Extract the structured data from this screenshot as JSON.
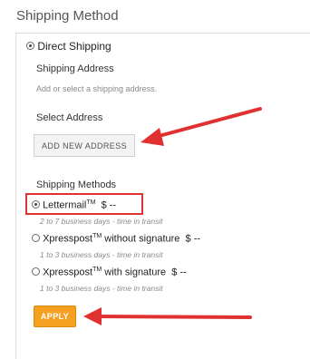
{
  "page": {
    "title": "Shipping Method"
  },
  "delivery": {
    "option_label": "Direct Shipping",
    "selected": true
  },
  "address": {
    "heading": "Shipping Address",
    "hint": "Add or select a shipping address.",
    "select_label": "Select Address",
    "add_button_label": "ADD NEW ADDRESS"
  },
  "methods": {
    "heading": "Shipping Methods",
    "items": [
      {
        "name": "Lettermail",
        "tm": "TM",
        "qualifier": "",
        "price": "$ --",
        "transit": "2 to 7 business days - time in transit",
        "selected": true
      },
      {
        "name": "Xpresspost",
        "tm": "TM",
        "qualifier": " without signature",
        "price": "$ --",
        "transit": "1 to 3 business days - time in transit",
        "selected": false
      },
      {
        "name": "Xpresspost",
        "tm": "TM",
        "qualifier": " with signature",
        "price": "$ --",
        "transit": "1 to 3 business days - time in transit",
        "selected": false
      }
    ]
  },
  "actions": {
    "apply_label": "APPLY"
  },
  "colors": {
    "accent": "#f5a020",
    "annotation": "#e03030"
  }
}
